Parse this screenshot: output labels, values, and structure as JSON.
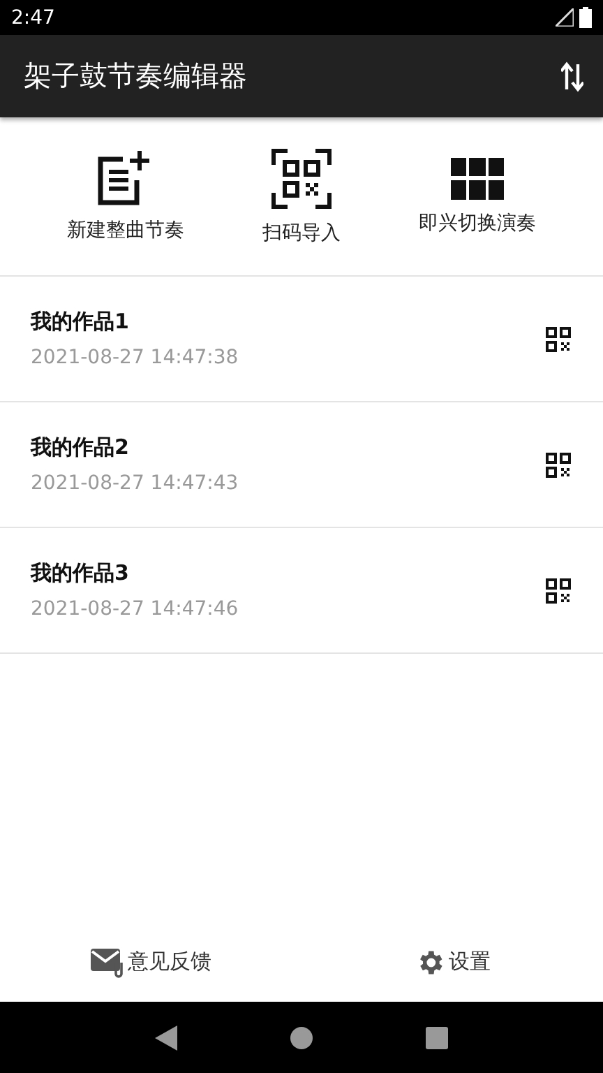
{
  "status_bar": {
    "time": "2:47"
  },
  "app_bar": {
    "title": "架子鼓节奏编辑器"
  },
  "actions": [
    {
      "kind": "new",
      "label": "新建整曲节奏"
    },
    {
      "kind": "scan",
      "label": "扫码导入"
    },
    {
      "kind": "grid",
      "label": "即兴切换演奏"
    }
  ],
  "works": [
    {
      "name": "我的作品1",
      "time": "2021-08-27 14:47:38"
    },
    {
      "name": "我的作品2",
      "time": "2021-08-27 14:47:43"
    },
    {
      "name": "我的作品3",
      "time": "2021-08-27 14:47:46"
    }
  ],
  "bottom_bar": [
    {
      "kind": "feedback",
      "label": "意见反馈"
    },
    {
      "kind": "settings",
      "label": "设置"
    }
  ]
}
